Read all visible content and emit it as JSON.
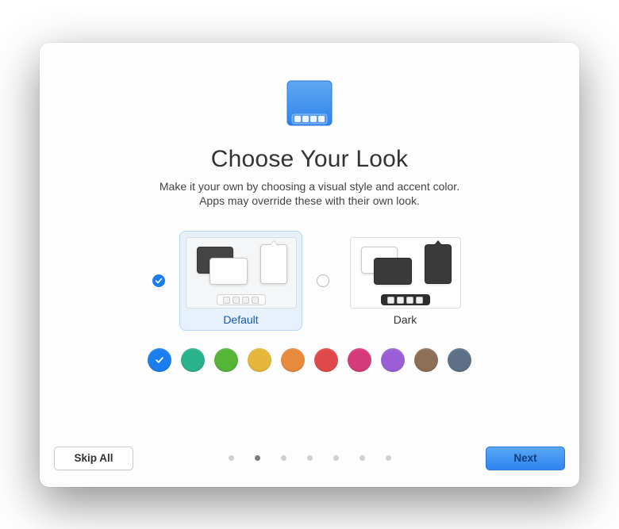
{
  "header": {
    "title": "Choose Your Look",
    "subtitle": "Make it your own by choosing a visual style and accent color.\nApps may override these with their own look."
  },
  "styles": {
    "options": [
      {
        "id": "default",
        "label": "Default",
        "selected": true
      },
      {
        "id": "dark",
        "label": "Dark",
        "selected": false
      }
    ]
  },
  "accent_colors": [
    {
      "name": "blue",
      "hex": "#1b7eee",
      "selected": true
    },
    {
      "name": "teal",
      "hex": "#2ab28a",
      "selected": false
    },
    {
      "name": "green",
      "hex": "#54b537",
      "selected": false
    },
    {
      "name": "yellow",
      "hex": "#e5b73a",
      "selected": false
    },
    {
      "name": "orange",
      "hex": "#e88a3e",
      "selected": false
    },
    {
      "name": "red",
      "hex": "#df4949",
      "selected": false
    },
    {
      "name": "pink",
      "hex": "#d63b7a",
      "selected": false
    },
    {
      "name": "purple",
      "hex": "#9a5fd6",
      "selected": false
    },
    {
      "name": "brown",
      "hex": "#8d6e56",
      "selected": false
    },
    {
      "name": "slate",
      "hex": "#5c7188",
      "selected": false
    }
  ],
  "progress": {
    "total": 7,
    "current_index": 1
  },
  "footer": {
    "skip_label": "Skip All",
    "next_label": "Next"
  }
}
